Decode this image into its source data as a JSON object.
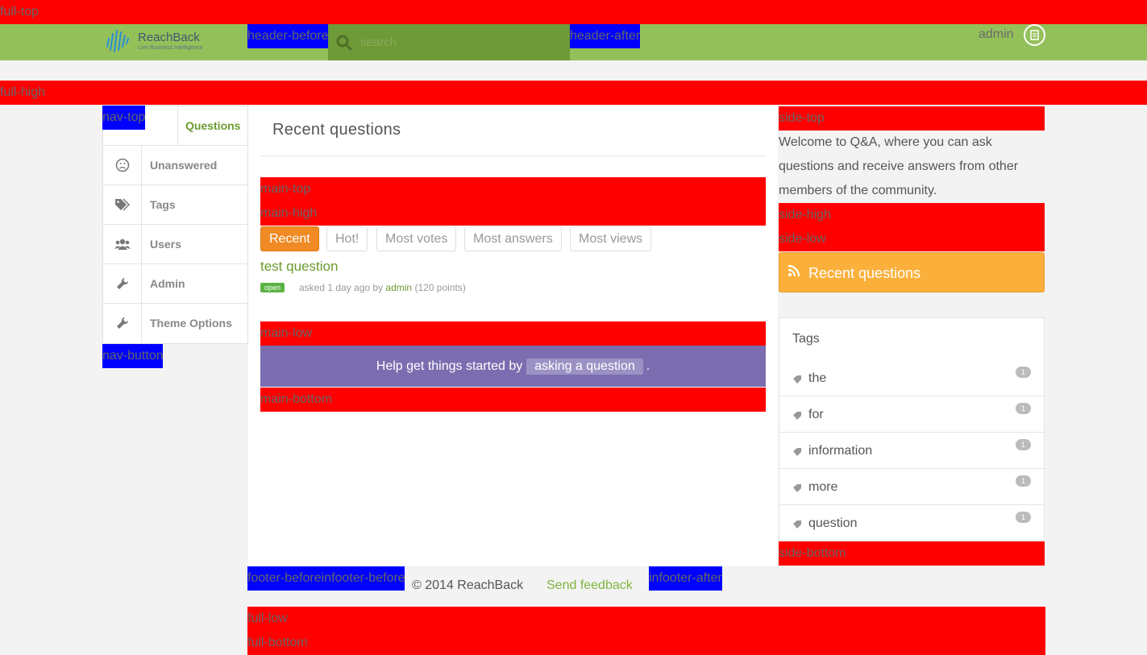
{
  "markers": {
    "full_top": "full-top",
    "full_high": "full-high",
    "header_before": "header-before",
    "header_after": "header-after",
    "nav_top": "nav-top",
    "nav_button": "nav-button",
    "main_top": "main-top",
    "main_high": "main-high",
    "main_low": "main-low",
    "main_bottom": "main-bottom",
    "side_top": "side-top",
    "side_high": "side-high",
    "side_low": "side-low",
    "side_bottom": "side-bottom",
    "footer_before": "footer-before",
    "infooter_before": "infooter-before",
    "infooter_after": "infooter-after",
    "full_low": "full-low",
    "full_bottom": "full-bottom"
  },
  "header": {
    "logo_text": "ReachBack",
    "logo_tagline": "Live Business Intelligence",
    "search_placeholder": "search",
    "user_name": "admin"
  },
  "nav": {
    "items": [
      {
        "label": "Questions",
        "icon": "speech-bubble-icon"
      },
      {
        "label": "Unanswered",
        "icon": "sad-face-icon"
      },
      {
        "label": "Tags",
        "icon": "tags-icon"
      },
      {
        "label": "Users",
        "icon": "users-icon"
      },
      {
        "label": "Admin",
        "icon": "wrench-icon"
      },
      {
        "label": "Theme Options",
        "icon": "wrench-icon"
      }
    ]
  },
  "main": {
    "title": "Recent questions",
    "tabs": [
      {
        "label": "Recent"
      },
      {
        "label": "Hot!"
      },
      {
        "label": "Most votes"
      },
      {
        "label": "Most answers"
      },
      {
        "label": "Most views"
      }
    ],
    "question": {
      "title": "test question",
      "status": "open",
      "asked": "asked 1 day ago by",
      "author": "admin",
      "points": "(120 points)"
    },
    "help_text": "Help get things started by",
    "help_link": "asking a question",
    "help_end": "."
  },
  "side": {
    "welcome": "Welcome to Q&A, where you can ask questions and receive answers from other members of the community.",
    "feed_label": "Recent questions",
    "tags_heading": "Tags",
    "tags": [
      {
        "name": "the",
        "count": "1"
      },
      {
        "name": "for",
        "count": "1"
      },
      {
        "name": "information",
        "count": "1"
      },
      {
        "name": "more",
        "count": "1"
      },
      {
        "name": "question",
        "count": "1"
      }
    ]
  },
  "footer": {
    "copyright": "© 2014 ReachBack",
    "feedback": "Send feedback"
  },
  "colors": {
    "header": "#94c05a",
    "accent_green": "#6a9b2f",
    "tab_active": "#f08a24",
    "feed_bar": "#fbb03b",
    "help_bar": "#7b6db0",
    "marker_red": "#ff0000",
    "marker_blue": "#0000ff"
  }
}
